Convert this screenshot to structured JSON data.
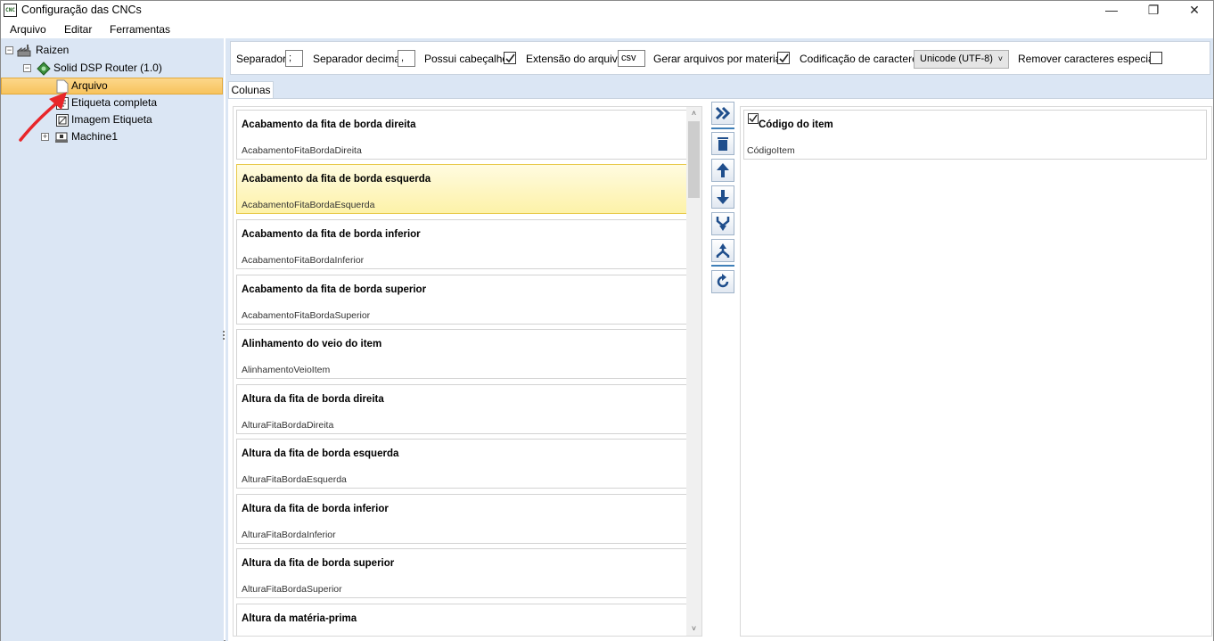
{
  "window": {
    "title": "Configuração das CNCs",
    "icon_text": "CNC",
    "minimize_glyph": "—",
    "maximize_glyph": "❐",
    "close_glyph": "✕"
  },
  "menu": [
    "Arquivo",
    "Editar",
    "Ferramentas"
  ],
  "tree": {
    "root": {
      "label": "Raizen",
      "expander": "⊟",
      "icon": "factory-icon"
    },
    "machine_type": {
      "label": "Solid DSP Router (1.0)",
      "expander": "⊟",
      "icon": "green-diamond-icon"
    },
    "children": [
      {
        "label": "Arquivo",
        "icon": "file-icon",
        "selected": true
      },
      {
        "label": "Etiqueta completa",
        "icon": "label-icon"
      },
      {
        "label": "Imagem Etiqueta",
        "icon": "label-image-icon"
      }
    ],
    "machine": {
      "label": "Machine1",
      "expander": "⊞",
      "icon": "machine-icon"
    }
  },
  "toolbar": {
    "separator_label": "Separador",
    "separator_value": ";",
    "decimal_label": "Separador decimal",
    "decimal_value": ",",
    "header_label": "Possui cabeçalho",
    "header_checked": true,
    "extension_label": "Extensão do arquivo",
    "extension_value": "csv",
    "per_material_label": "Gerar arquivos por material",
    "per_material_checked": true,
    "encoding_label": "Codificação de caracteres",
    "encoding_value": "Unicode (UTF-8)",
    "remove_special_label": "Remover caracteres especiais",
    "remove_special_checked": false
  },
  "tabs": [
    "Colunas"
  ],
  "columns": [
    {
      "title": "Acabamento da fita de borda direita",
      "key": "AcabamentoFitaBordaDireita"
    },
    {
      "title": "Acabamento da fita de borda esquerda",
      "key": "AcabamentoFitaBordaEsquerda",
      "highlighted": true
    },
    {
      "title": "Acabamento da fita de borda inferior",
      "key": "AcabamentoFitaBordaInferior"
    },
    {
      "title": "Acabamento da fita de borda superior",
      "key": "AcabamentoFitaBordaSuperior"
    },
    {
      "title": "Alinhamento do veio do item",
      "key": "AlinhamentoVeioItem"
    },
    {
      "title": "Altura da fita de borda direita",
      "key": "AlturaFitaBordaDireita"
    },
    {
      "title": "Altura da fita de borda esquerda",
      "key": "AlturaFitaBordaEsquerda"
    },
    {
      "title": "Altura da fita de borda inferior",
      "key": "AlturaFitaBordaInferior"
    },
    {
      "title": "Altura da fita de borda superior",
      "key": "AlturaFitaBordaSuperior"
    },
    {
      "title": "Altura da matéria-prima",
      "key": ""
    }
  ],
  "actions": [
    "add-all-icon",
    "delete-icon",
    "move-up-icon",
    "move-down-icon",
    "merge-icon",
    "split-icon",
    "refresh-icon"
  ],
  "selected_columns": [
    {
      "title": "Código do item",
      "key": "CódigoItem",
      "checked": true
    }
  ],
  "colors": {
    "pane_bg": "#dbe6f4",
    "selection": "#f7c35d",
    "highlight": "#fdf2a8",
    "accent": "#3f7fb8",
    "annotation": "#e8262a"
  }
}
